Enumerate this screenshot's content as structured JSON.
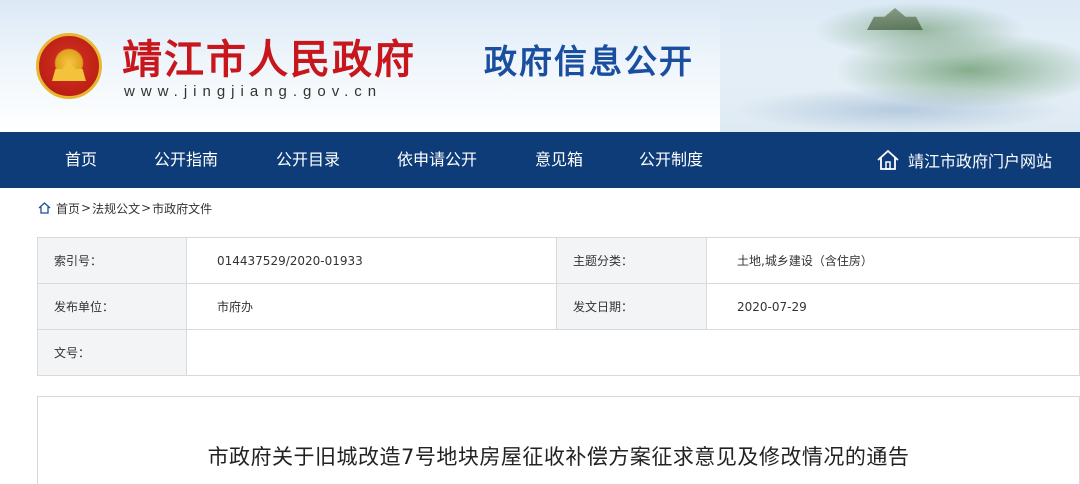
{
  "header": {
    "site_name": "靖江市人民政府",
    "site_url": "www.jingjiang.gov.cn",
    "section_title": "政府信息公开"
  },
  "nav": {
    "items": [
      "首页",
      "公开指南",
      "公开目录",
      "依申请公开",
      "意见箱",
      "公开制度"
    ],
    "portal_link": "靖江市政府门户网站"
  },
  "breadcrumb": {
    "items": [
      "首页",
      "法规公文",
      "市政府文件"
    ],
    "separator": ">"
  },
  "info": {
    "index_label": "索引号：",
    "index_value": "014437529/2020-01933",
    "topic_label": "主题分类：",
    "topic_value": "土地,城乡建设（含住房）",
    "publisher_label": "发布单位：",
    "publisher_value": "市府办",
    "date_label": "发文日期：",
    "date_value": "2020-07-29",
    "doc_no_label": "文号：",
    "doc_no_value": ""
  },
  "article": {
    "title": "市政府关于旧城改造7号地块房屋征收补偿方案征求意见及修改情况的通告"
  },
  "colors": {
    "brand_red": "#c8161d",
    "brand_blue": "#1a4fa0",
    "nav_bg": "#0d3c78"
  }
}
